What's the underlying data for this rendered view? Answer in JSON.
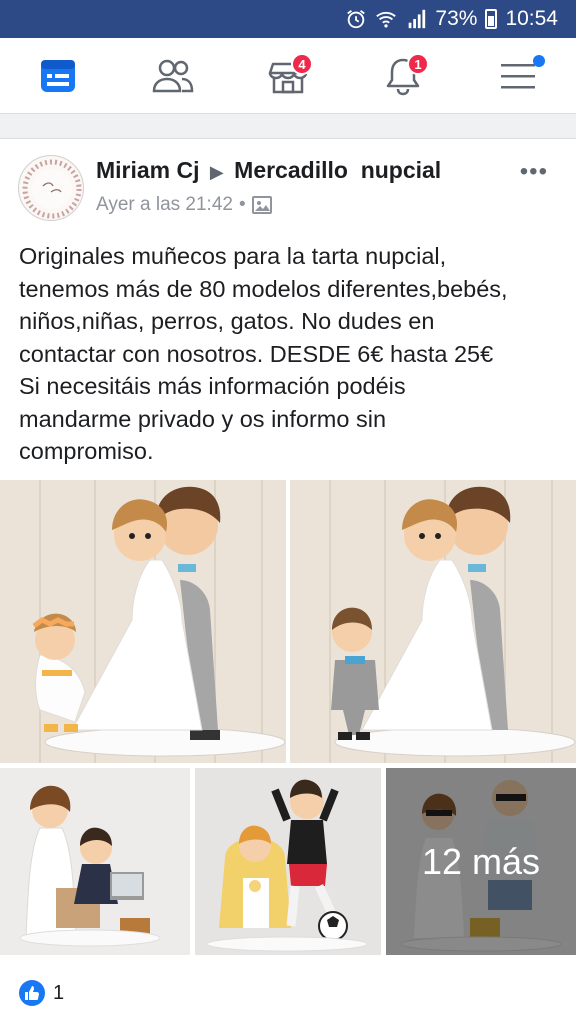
{
  "status_bar": {
    "battery": "73%",
    "time": "10:54"
  },
  "nav": {
    "items": [
      {
        "name": "news-feed",
        "badge": ""
      },
      {
        "name": "friends",
        "badge": ""
      },
      {
        "name": "marketplace",
        "badge": "4"
      },
      {
        "name": "notifications",
        "badge": "1"
      },
      {
        "name": "menu",
        "badge": ""
      }
    ],
    "accent": "#1877f2"
  },
  "post": {
    "author": "Miriam Cj",
    "group": "Mercadillo  nupcial",
    "time": "Ayer a las 21:42",
    "separator": "•",
    "text": "Originales muñecos para la tarta nupcial,\ntenemos más de 80 modelos diferentes,bebés,\nniños,niñas, perros, gatos. No dudes en\ncontactar con nosotros. DESDE 6€ hasta 25€\nSi necesitáis más información podéis\nmandarme privado y os informo sin\ncompromiso.",
    "more_photos": "12 más",
    "reaction_count": "1"
  }
}
